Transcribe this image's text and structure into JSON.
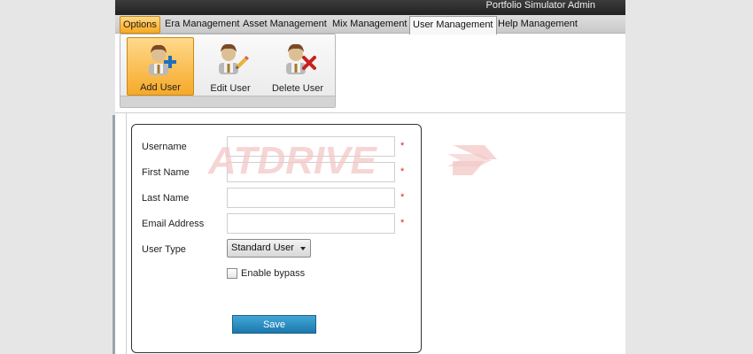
{
  "window": {
    "title": "Portfolio Simulator Admin"
  },
  "tabs": [
    {
      "label": "Options"
    },
    {
      "label": "Era Management"
    },
    {
      "label": "Asset Management"
    },
    {
      "label": "Mix Management"
    },
    {
      "label": "User Management"
    },
    {
      "label": "Help Management"
    }
  ],
  "active_tab": "User Management",
  "ribbon": {
    "add_user": "Add User",
    "edit_user": "Edit User",
    "delete_user": "Delete User"
  },
  "form": {
    "username_label": "Username",
    "first_name_label": "First Name",
    "last_name_label": "Last Name",
    "email_label": "Email Address",
    "user_type_label": "User Type",
    "required_marker": "*",
    "username_value": "",
    "first_name_value": "",
    "last_name_value": "",
    "email_value": "",
    "user_type_value": "Standard User",
    "enable_bypass_label": "Enable bypass",
    "enable_bypass_checked": false,
    "save_label": "Save"
  },
  "watermark": {
    "text": "ATDRIVE"
  },
  "colors": {
    "accent_orange": "#f6a928",
    "save_blue": "#1c78ac",
    "required_red": "#d22222",
    "watermark_red": "#f3c7c7"
  }
}
